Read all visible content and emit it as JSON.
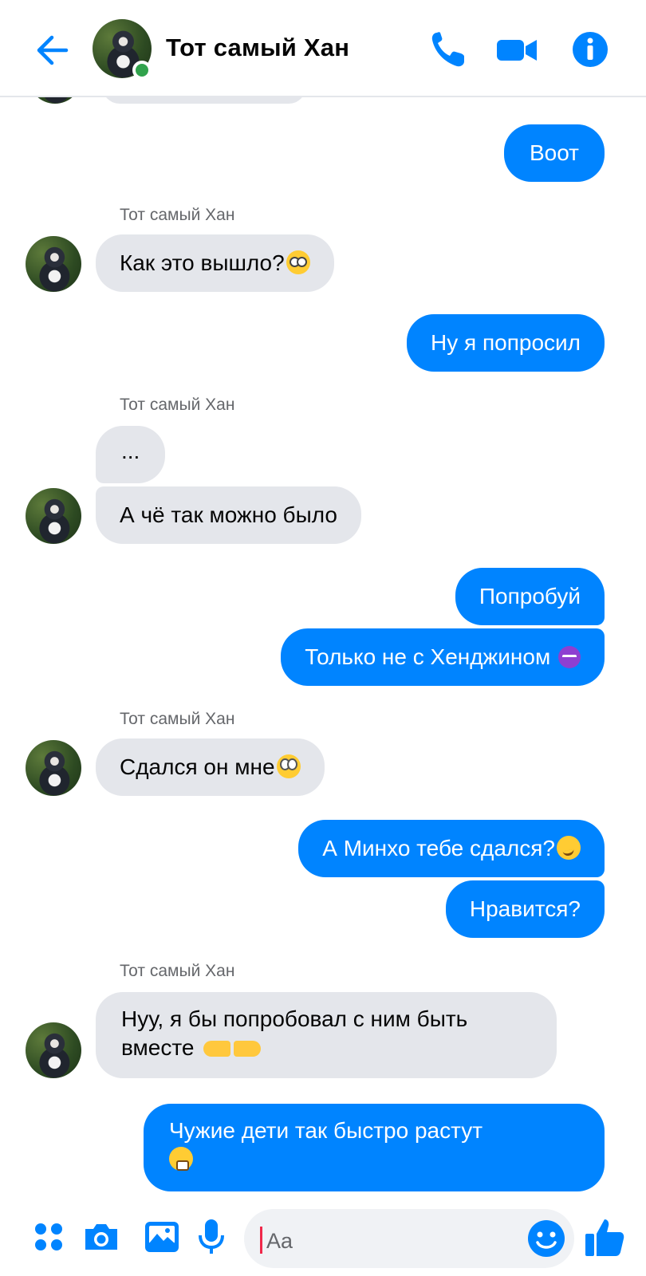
{
  "header": {
    "title": "Тот самый Хан",
    "accent": "#0084ff",
    "online_color": "#31a24c"
  },
  "messages": [
    {
      "dir": "out",
      "text": "Воот"
    },
    {
      "dir": "in",
      "sender": "Тот самый Хан",
      "text": "Как это вышло?",
      "emoji": "flushed-face"
    },
    {
      "dir": "out",
      "text": "Ну я попросил"
    },
    {
      "dir": "in",
      "sender": "Тот самый Хан",
      "text": "..."
    },
    {
      "dir": "in",
      "text": "А чё так можно было"
    },
    {
      "dir": "out",
      "text": "Попробуй"
    },
    {
      "dir": "out",
      "text": "Только не с Хенджином",
      "emoji": "angry-devil"
    },
    {
      "dir": "in",
      "sender": "Тот самый Хан",
      "text": "Сдался он мне",
      "emoji": "rolling-eyes"
    },
    {
      "dir": "out",
      "text": "А Минхо тебе сдался?",
      "emoji": "smirking-face"
    },
    {
      "dir": "out",
      "text": "Нравится?"
    },
    {
      "dir": "in",
      "sender": "Тот самый Хан",
      "text": "Нуу, я бы попробовал с ним быть вместе",
      "emoji": "pointing-hands"
    },
    {
      "dir": "out",
      "text": "Чужие дети так быстро растут",
      "emoji": "crying-face"
    }
  ],
  "composer": {
    "placeholder": "Aa",
    "icons": [
      "menu-dots-icon",
      "camera-icon",
      "gallery-icon",
      "microphone-icon",
      "emoji-icon",
      "thumbs-up-icon"
    ]
  }
}
